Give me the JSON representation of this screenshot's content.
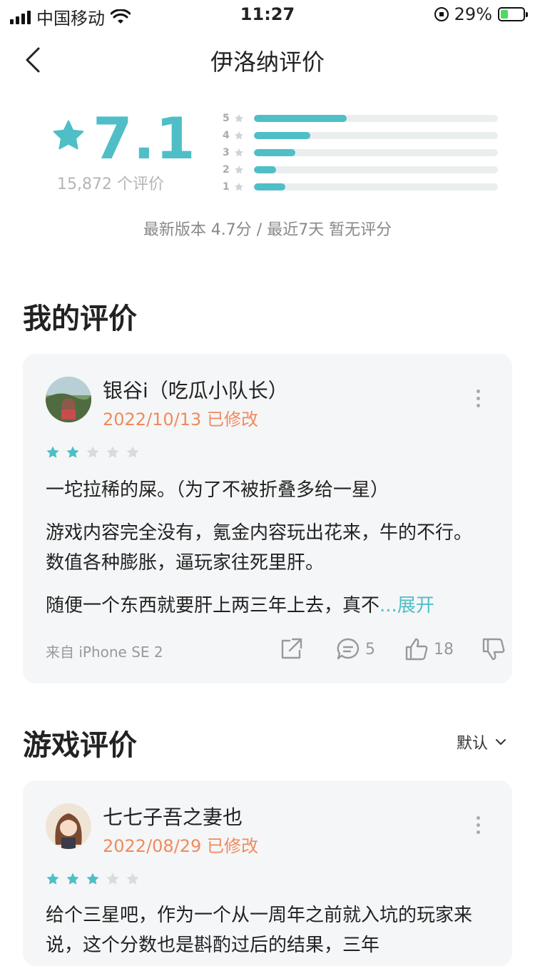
{
  "status_bar": {
    "carrier": "中国移动",
    "time": "11:27",
    "battery": "29%"
  },
  "nav": {
    "title": "伊洛纳评价"
  },
  "rating": {
    "score": "7.1",
    "count_label": "15,872 个评价",
    "distribution": [
      {
        "star": "5",
        "fraction": 0.38
      },
      {
        "star": "4",
        "fraction": 0.23
      },
      {
        "star": "3",
        "fraction": 0.17
      },
      {
        "star": "2",
        "fraction": 0.09
      },
      {
        "star": "1",
        "fraction": 0.13
      }
    ],
    "summary": "最新版本 4.7分 / 最近7天 暂无评分"
  },
  "my_review_section": {
    "title": "我的评价",
    "review": {
      "username": "银谷i（吃瓜小队长）",
      "date": "2022/10/13 已修改",
      "stars": 2,
      "line1": "一坨拉稀的屎。（为了不被折叠多给一星）",
      "line2": "游戏内容完全没有，氪金内容玩出花来，牛的不行。数值各种膨胀，逼玩家往死里肝。",
      "line3": "随便一个东西就要肝上两三年上去，真不",
      "ellipsis": "...",
      "expand": "展开",
      "device": "来自 iPhone SE 2",
      "comments": "5",
      "likes": "18"
    }
  },
  "game_review_section": {
    "title": "游戏评价",
    "sort_label": "默认",
    "review": {
      "username": "七七子吾之妻也",
      "date": "2022/08/29 已修改",
      "stars": 3,
      "text": "给个三星吧，作为一个从一周年之前就入坑的玩家来说，这个分数也是斟酌过后的结果，三年"
    }
  },
  "colors": {
    "accent": "#4fbec7",
    "date": "#f08a5d",
    "card_bg": "#f5f6f7",
    "star_empty": "#d8dcde"
  },
  "icons": [
    "signal-icon",
    "wifi-icon",
    "orientation-lock-icon",
    "battery-icon",
    "back-arrow-icon",
    "star-icon",
    "more-icon",
    "share-icon",
    "comment-icon",
    "thumbs-up-icon",
    "thumbs-down-icon",
    "chevron-down-icon"
  ]
}
